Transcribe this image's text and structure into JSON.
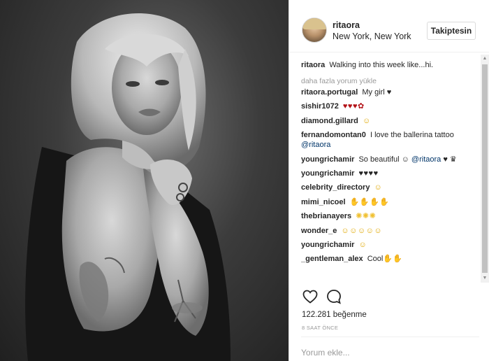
{
  "post": {
    "username": "ritaora",
    "location": "New York, New York",
    "follow_label": "Takiptesin",
    "caption_user": "ritaora",
    "caption_text": "Walking into this week like...hi.",
    "load_more": "daha fazla yorum yükle",
    "comments": [
      {
        "user": "ritaora.portugal",
        "text": "My girl ♥"
      },
      {
        "user": "sishir1072",
        "text": "♥♥♥✿"
      },
      {
        "user": "diamond.gillard",
        "text": "☺"
      },
      {
        "user": "fernandomontan0",
        "text": "I love the ballerina tattoo",
        "mention": "@ritaora"
      },
      {
        "user": "youngrichamir",
        "text": "So beautiful ☺",
        "mention": "@ritaora",
        "after": "♥ ♛"
      },
      {
        "user": "youngrichamir",
        "text": "♥♥♥♥"
      },
      {
        "user": "celebrity_directory",
        "text": "☺"
      },
      {
        "user": "mimi_nicoel",
        "text": "✋✋✋✋"
      },
      {
        "user": "thebrianayers",
        "text": "✺✺✺"
      },
      {
        "user": "wonder_e",
        "text": "☺☺☺☺☺"
      },
      {
        "user": "youngrichamir",
        "text": "☺"
      },
      {
        "user": "_gentleman_alex",
        "text": "Cool✋✋"
      }
    ],
    "likes": "122.281 beğenme",
    "time_ago": "8 SAAT ÖNCE",
    "comment_placeholder": "Yorum ekle..."
  },
  "icons": {
    "like": "heart-icon",
    "comment": "comment-icon",
    "scroll_up": "scroll-up-arrow",
    "scroll_down": "scroll-down-arrow"
  },
  "colors": {
    "text": "#262626",
    "muted": "#999999",
    "mention": "#003569",
    "emoji_heart": "#b31217",
    "emoji_yellow": "#f5c518"
  }
}
